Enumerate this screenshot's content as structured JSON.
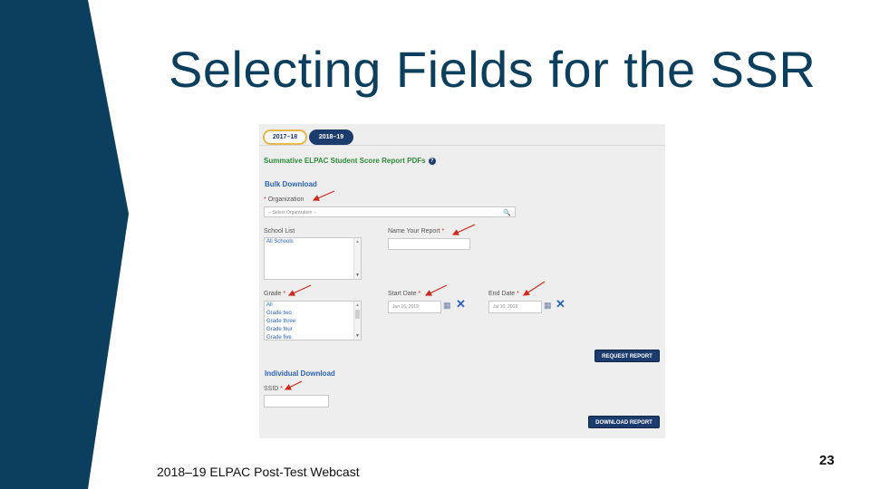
{
  "slide": {
    "title": "Selecting Fields for the SSR",
    "footer": "2018–19 ELPAC Post-Test Webcast",
    "page_number": "23",
    "colors": {
      "band": "#0c3f5d",
      "title": "#0c3f5d"
    }
  },
  "screenshot": {
    "tabs": [
      {
        "label": "2017–18",
        "selected": false
      },
      {
        "label": "2018–19",
        "selected": true
      }
    ],
    "heading": "Summative ELPAC Student Score Report PDFs",
    "help_icon": "?",
    "bulk": {
      "heading": "Bulk Download",
      "organization": {
        "required": "*",
        "label": "Organization",
        "placeholder": "-- Select Organization --",
        "icon": "search-icon"
      },
      "school_list": {
        "label": "School List",
        "items": [
          "All Schools"
        ]
      },
      "report_name": {
        "label": "Name Your Report",
        "required": "*",
        "value": ""
      },
      "grade": {
        "label": "Grade",
        "required": "*",
        "items": [
          "All",
          "Grade two",
          "Grade three",
          "Grade four",
          "Grade five"
        ]
      },
      "start_date": {
        "label": "Start Date",
        "required": "*",
        "value": "Jun 16, 2019"
      },
      "end_date": {
        "label": "End Date",
        "required": "*",
        "value": "Jul 10, 2019"
      },
      "request_button": "REQUEST REPORT"
    },
    "individual": {
      "heading": "Individual Download",
      "ssid": {
        "label": "SSID",
        "required": "*",
        "value": ""
      },
      "download_button": "DOWNLOAD REPORT"
    },
    "colors": {
      "heading_green": "#2e8b3a",
      "section_blue": "#2b62b8",
      "button_navy": "#1d3c6e",
      "arrow_red": "#d0271d"
    }
  }
}
